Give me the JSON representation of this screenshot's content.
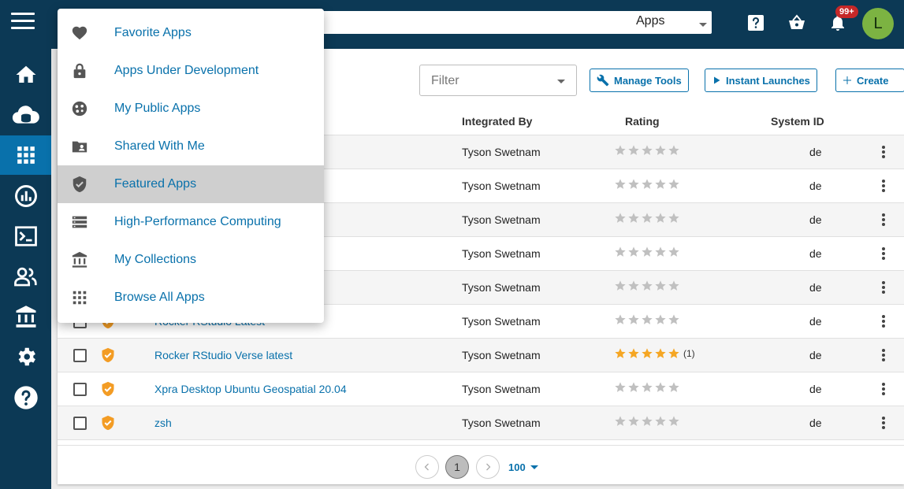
{
  "header": {
    "search_scope": "Apps",
    "notification_count": "99+",
    "user_initial": "L"
  },
  "nav": [
    "home",
    "data",
    "apps",
    "analyses",
    "vice",
    "teams",
    "collections",
    "settings",
    "help"
  ],
  "toolbar": {
    "filter_placeholder": "Filter",
    "manage_tools_label": "Manage Tools",
    "instant_launches_label": "Instant Launches",
    "create_label": "Create"
  },
  "table": {
    "headers": {
      "integrated_by": "Integrated By",
      "rating": "Rating",
      "system_id": "System ID"
    },
    "rows": [
      {
        "name": "",
        "integrator": "Tyson Swetnam",
        "stars": 0,
        "count": "",
        "system": "de"
      },
      {
        "name": "",
        "integrator": "Tyson Swetnam",
        "stars": 0,
        "count": "",
        "system": "de"
      },
      {
        "name": "",
        "integrator": "Tyson Swetnam",
        "stars": 0,
        "count": "",
        "system": "de"
      },
      {
        "name": "",
        "integrator": "Tyson Swetnam",
        "stars": 0,
        "count": "",
        "system": "de"
      },
      {
        "name": "",
        "integrator": "Tyson Swetnam",
        "stars": 0,
        "count": "",
        "system": "de"
      },
      {
        "name": "Rocker RStudio Latest",
        "integrator": "Tyson Swetnam",
        "stars": 0,
        "count": "",
        "system": "de"
      },
      {
        "name": "Rocker RStudio Verse latest",
        "integrator": "Tyson Swetnam",
        "stars": 5,
        "count": "(1)",
        "system": "de"
      },
      {
        "name": "Xpra Desktop Ubuntu Geospatial 20.04",
        "integrator": "Tyson Swetnam",
        "stars": 0,
        "count": "",
        "system": "de"
      },
      {
        "name": "zsh",
        "integrator": "Tyson Swetnam",
        "stars": 0,
        "count": "",
        "system": "de"
      }
    ]
  },
  "pagination": {
    "current_page": "1",
    "page_size": "100"
  },
  "menu": {
    "items": [
      {
        "label": "Favorite Apps",
        "icon": "heart-icon"
      },
      {
        "label": "Apps Under Development",
        "icon": "lock-icon"
      },
      {
        "label": "My Public Apps",
        "icon": "public-icon"
      },
      {
        "label": "Shared With Me",
        "icon": "shared-folder-icon"
      },
      {
        "label": "Featured Apps",
        "icon": "verified-shield-icon"
      },
      {
        "label": "High-Performance Computing",
        "icon": "server-icon"
      },
      {
        "label": "My Collections",
        "icon": "collections-icon"
      },
      {
        "label": "Browse All Apps",
        "icon": "grid-icon"
      }
    ],
    "selected_index": 4
  },
  "colors": {
    "brand_dark": "#0c3955",
    "accent_blue": "#0971ab",
    "featured_shield": "#f39c24",
    "star_filled": "#f5a623",
    "star_empty": "#c0c0c0"
  }
}
